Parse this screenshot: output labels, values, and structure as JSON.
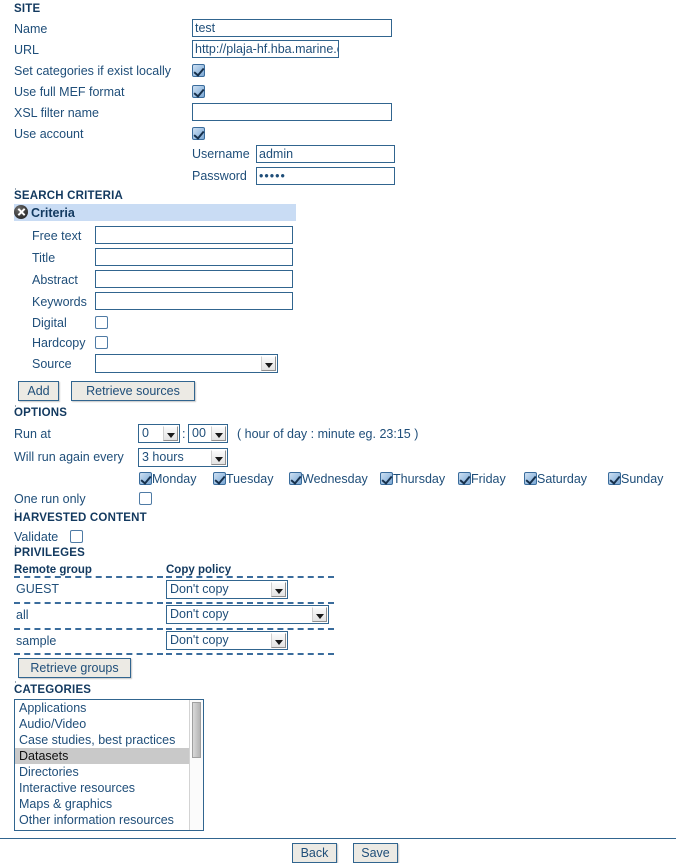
{
  "sections": {
    "site": "SITE",
    "search_criteria": "SEARCH CRITERIA",
    "options": "OPTIONS",
    "harvested_content": "HARVESTED CONTENT",
    "privileges": "PRIVILEGES",
    "categories": "CATEGORIES"
  },
  "site": {
    "name_label": "Name",
    "name_value": "test",
    "url_label": "URL",
    "url_value": "http://plaja-hf.hba.marine.csiro.",
    "set_categories_label": "Set categories if exist locally",
    "set_categories_checked": true,
    "use_mef_label": "Use full MEF format",
    "use_mef_checked": true,
    "xsl_filter_label": "XSL filter name",
    "xsl_filter_value": "",
    "use_account_label": "Use account",
    "use_account_checked": true,
    "username_label": "Username",
    "username_value": "admin",
    "password_label": "Password",
    "password_value": "•••••"
  },
  "criteria": {
    "title": "Criteria",
    "delete_icon": "close-circle-icon",
    "free_text_label": "Free text",
    "free_text_value": "",
    "title_label": "Title",
    "title_value": "",
    "abstract_label": "Abstract",
    "abstract_value": "",
    "keywords_label": "Keywords",
    "keywords_value": "",
    "digital_label": "Digital",
    "digital_checked": false,
    "hardcopy_label": "Hardcopy",
    "hardcopy_checked": false,
    "source_label": "Source",
    "source_value": "",
    "add_button": "Add",
    "retrieve_sources_button": "Retrieve sources"
  },
  "options": {
    "run_at_label": "Run at",
    "run_at_hour": "0",
    "run_at_separator": ":",
    "run_at_minute": "00",
    "run_at_hint": "( hour of day : minute eg. 23:15 )",
    "run_again_label": "Will run again every",
    "run_again_value": "3 hours",
    "days": [
      {
        "label": "Monday",
        "checked": true
      },
      {
        "label": "Tuesday",
        "checked": true
      },
      {
        "label": "Wednesday",
        "checked": true
      },
      {
        "label": "Thursday",
        "checked": true
      },
      {
        "label": "Friday",
        "checked": true
      },
      {
        "label": "Saturday",
        "checked": true
      },
      {
        "label": "Sunday",
        "checked": true
      }
    ],
    "one_run_only_label": "One run only",
    "one_run_only_checked": false
  },
  "harvested": {
    "validate_label": "Validate",
    "validate_checked": false
  },
  "privileges": {
    "col_group": "Remote group",
    "col_policy": "Copy policy",
    "rows": [
      {
        "group": "GUEST",
        "policy": "Don't copy"
      },
      {
        "group": "all",
        "policy": "Don't copy"
      },
      {
        "group": "sample",
        "policy": "Don't copy"
      }
    ],
    "retrieve_groups_button": "Retrieve groups"
  },
  "categories": {
    "items": [
      {
        "label": "Applications",
        "selected": false
      },
      {
        "label": "Audio/Video",
        "selected": false
      },
      {
        "label": "Case studies, best practices",
        "selected": false
      },
      {
        "label": "Datasets",
        "selected": true
      },
      {
        "label": "Directories",
        "selected": false
      },
      {
        "label": "Interactive resources",
        "selected": false
      },
      {
        "label": "Maps & graphics",
        "selected": false
      },
      {
        "label": "Other information resources",
        "selected": false
      }
    ]
  },
  "footer": {
    "back_button": "Back",
    "save_button": "Save"
  },
  "colors": {
    "label_blue": "#1f4e79",
    "heading_blue": "#12395f",
    "band_blue": "#c9dcf4",
    "border_blue": "#31658f",
    "selected_gray": "#c9c9c9"
  }
}
